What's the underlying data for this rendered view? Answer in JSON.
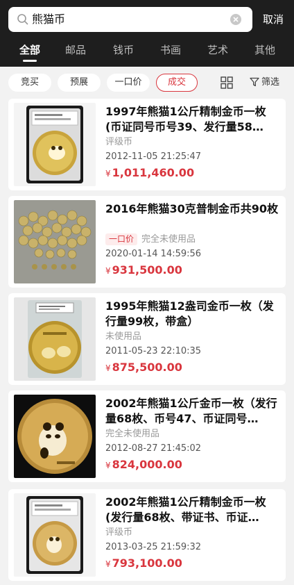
{
  "search": {
    "query": "熊猫币",
    "cancel_label": "取消"
  },
  "categories": [
    "全部",
    "邮品",
    "钱币",
    "书画",
    "艺术",
    "其他"
  ],
  "filters": {
    "chips": [
      "竞买",
      "预展",
      "一口价",
      "成交"
    ],
    "selected": "成交",
    "filter_label": "筛选"
  },
  "colors": {
    "accent": "#d9363e",
    "header": "#1e1e1e"
  },
  "items": [
    {
      "title": "1997年熊猫1公斤精制金币一枚(币证同号币号39、发行量58…",
      "tag": "",
      "condition": "评级币",
      "time": "2012-11-05 21:25:47",
      "currency": "¥",
      "price": "1,011,460.00",
      "image": "graded-slab-gold-panda-coin"
    },
    {
      "title": "2016年熊猫30克普制金币共90枚",
      "tag": "一口价",
      "condition": "完全未使用品",
      "time": "2020-01-14 14:59:56",
      "currency": "¥",
      "price": "931,500.00",
      "image": "pile-of-gold-coins"
    },
    {
      "title": "1995年熊猫12盎司金币一枚（发行量99枚，带盒）",
      "tag": "",
      "condition": "未使用品",
      "time": "2011-05-23 22:10:35",
      "currency": "¥",
      "price": "875,500.00",
      "image": "sealed-gold-panda-coin"
    },
    {
      "title": "2002年熊猫1公斤金币一枚（发行量68枚、币号47、币证同号…",
      "tag": "",
      "condition": "完全未使用品",
      "time": "2012-08-27 21:45:02",
      "currency": "¥",
      "price": "824,000.00",
      "image": "gold-panda-coin-black-background"
    },
    {
      "title": "2002年熊猫1公斤精制金币一枚(发行量68枚、带证书、币证…",
      "tag": "",
      "condition": "评级币",
      "time": "2013-03-25 21:59:32",
      "currency": "¥",
      "price": "793,100.00",
      "image": "graded-slab-gold-panda-coin"
    }
  ]
}
